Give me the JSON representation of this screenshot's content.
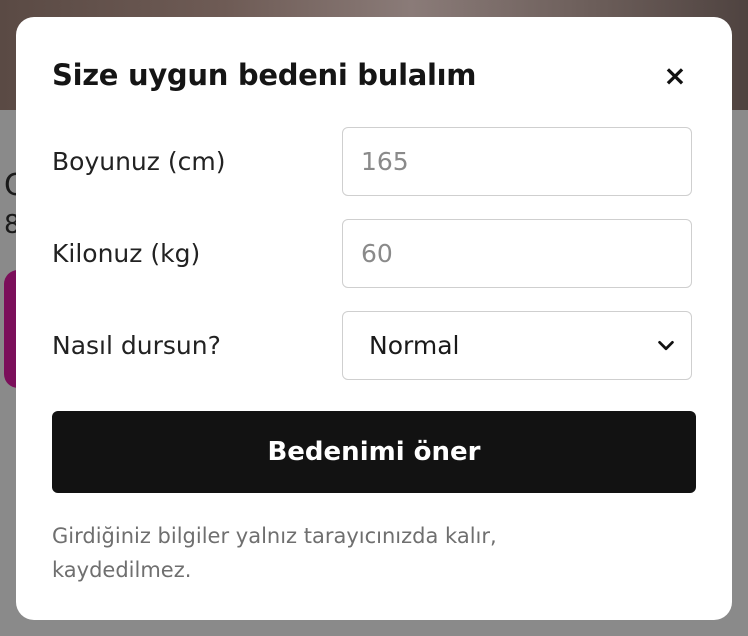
{
  "modal": {
    "title": "Size uygun bedeni bulalım",
    "close_icon": "×"
  },
  "form": {
    "height": {
      "label": "Boyunuz (cm)",
      "placeholder": "165",
      "value": ""
    },
    "weight": {
      "label": "Kilonuz (kg)",
      "placeholder": "60",
      "value": ""
    },
    "fit": {
      "label": "Nasıl dursun?",
      "selected": "Normal"
    }
  },
  "submit": {
    "label": "Bedenimi öner"
  },
  "note": "Girdiğiniz bilgiler yalnız tarayıcınızda kalır, kaydedilmez.",
  "background": {
    "text1": "C",
    "text2": "8"
  },
  "colors": {
    "overlay": "#8a8a8a",
    "modal_bg": "#ffffff",
    "button_bg": "#121212",
    "accent_pill": "#7b0f5a"
  }
}
